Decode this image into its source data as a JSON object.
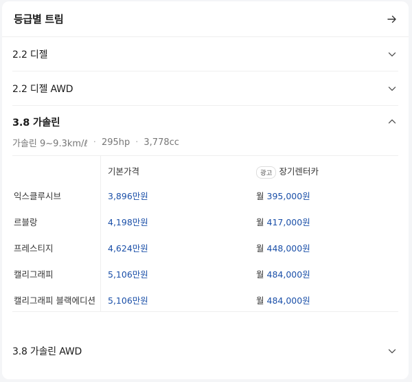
{
  "header": {
    "title": "등급별 트림"
  },
  "trims": [
    {
      "label": "2.2 디젤"
    },
    {
      "label": "2.2 디젤 AWD"
    },
    {
      "label": "3.8 가솔린"
    },
    {
      "label": "3.8 가솔린 AWD"
    }
  ],
  "expanded": {
    "specs": {
      "fuel": "가솔린 9~9.3km/ℓ",
      "power": "295hp",
      "displacement": "3,778cc"
    },
    "table": {
      "col_price": "기본가격",
      "ad_badge": "광고",
      "col_rent": "장기렌터카",
      "rent_prefix": "월",
      "rows": [
        {
          "name": "익스클루시브",
          "price": "3,896만원",
          "rent": "395,000원"
        },
        {
          "name": "르블랑",
          "price": "4,198만원",
          "rent": "417,000원"
        },
        {
          "name": "프레스티지",
          "price": "4,624만원",
          "rent": "448,000원"
        },
        {
          "name": "캘리그래피",
          "price": "5,106만원",
          "rent": "484,000원"
        },
        {
          "name": "캘리그래피 블랙에디션",
          "price": "5,106만원",
          "rent": "484,000원"
        }
      ]
    }
  }
}
